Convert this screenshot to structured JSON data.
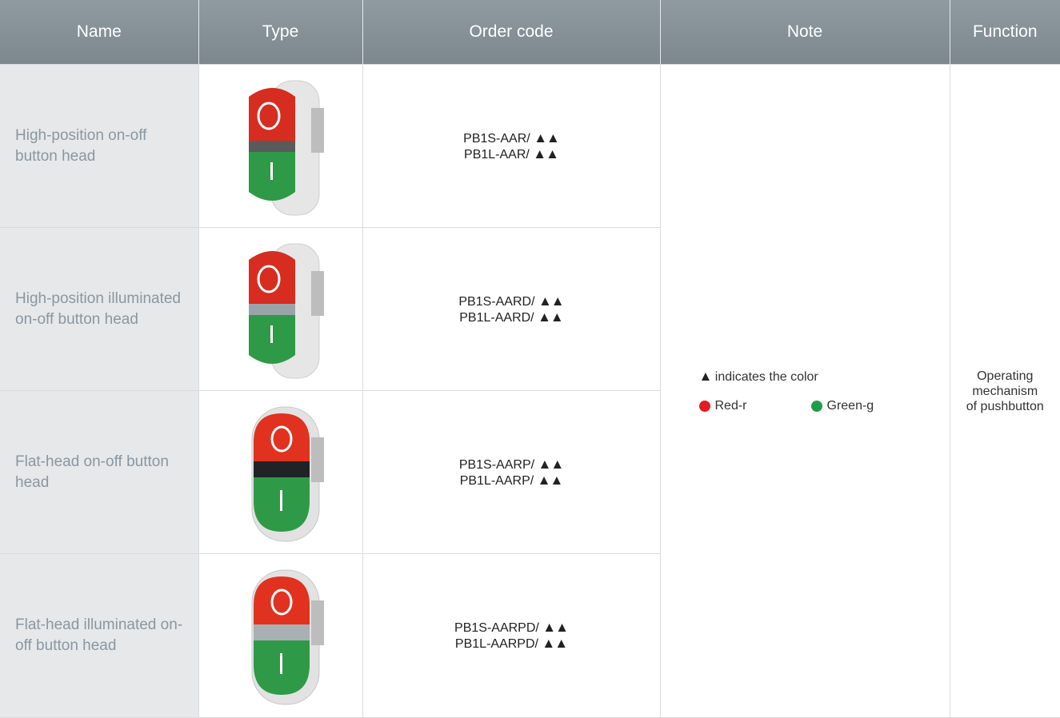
{
  "headers": {
    "name": "Name",
    "type": "Type",
    "order_code": "Order code",
    "note": "Note",
    "function": "Function"
  },
  "rows": [
    {
      "name": "High-position on-off button head",
      "code1": "PB1S-AAR/",
      "code2": "PB1L-AAR/",
      "image": "high-position-button-icon"
    },
    {
      "name": "High-position illuminated on-off button head",
      "code1": "PB1S-AARD/",
      "code2": "PB1L-AARD/",
      "image": "high-position-illuminated-button-icon"
    },
    {
      "name": "Flat-head on-off button head",
      "code1": "PB1S-AARP/",
      "code2": "PB1L-AARP/",
      "image": "flat-head-button-icon"
    },
    {
      "name": "Flat-head illuminated on-off button head",
      "code1": "PB1S-AARPD/",
      "code2": "PB1L-AARPD/",
      "image": "flat-head-illuminated-button-icon"
    }
  ],
  "triangles": "▲▲",
  "note": {
    "triangle": "▲",
    "text": "indicates the color",
    "red_label": "Red-r",
    "green_label": "Green-g"
  },
  "function": {
    "line1": "Operating",
    "line2": "mechanism",
    "line3": "of pushbutton"
  },
  "colors": {
    "header": "#8a959c",
    "name_bg": "#e7e8e9",
    "name_text": "#8a97a2",
    "red": "#e31b23",
    "green": "#1e9e4a"
  }
}
